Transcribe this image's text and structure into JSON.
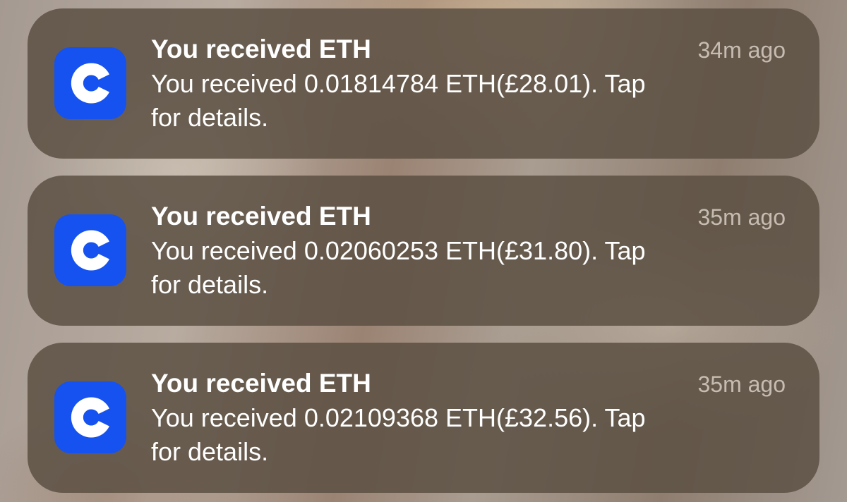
{
  "notifications": [
    {
      "app_icon": "coinbase-c-logo",
      "title": "You received ETH",
      "time": "34m ago",
      "body_line1": "You received 0.01814784 ETH(£28.01). Tap",
      "body_line2": "for details."
    },
    {
      "app_icon": "coinbase-c-logo",
      "title": "You received ETH",
      "time": "35m ago",
      "body_line1": "You received 0.02060253 ETH(£31.80). Tap",
      "body_line2": "for details."
    },
    {
      "app_icon": "coinbase-c-logo",
      "title": "You received ETH",
      "time": "35m ago",
      "body_line1": "You received 0.02109368 ETH(£32.56). Tap",
      "body_line2": "for details."
    }
  ],
  "colors": {
    "brand_blue": "#1652f0",
    "card_background": "#5c5044",
    "title_text": "#ffffff",
    "time_text": "#c7bcb1"
  }
}
